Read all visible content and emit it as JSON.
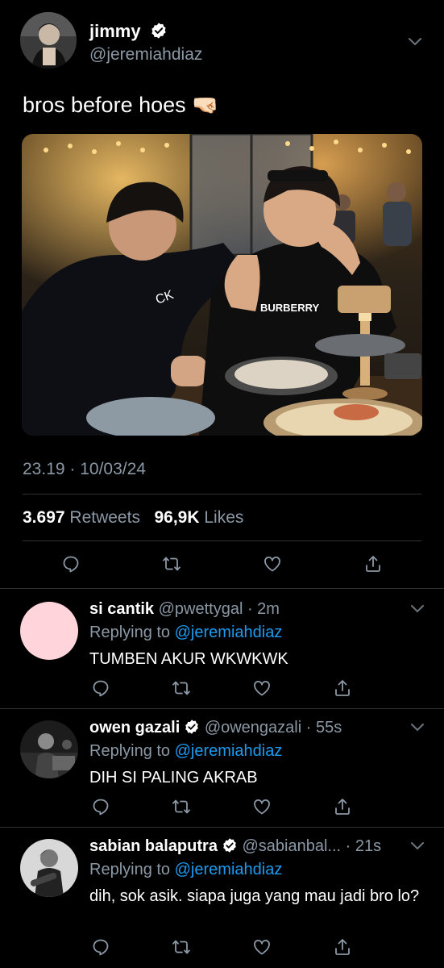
{
  "tweet": {
    "display_name": "jimmy",
    "handle": "@jeremiahdiaz",
    "text": "bros before hoes 🤜🏻",
    "time": "23.19 · 10/03/24",
    "retweets": "3.697",
    "retweets_label": "Retweets",
    "likes": "96,9K",
    "likes_label": "Likes"
  },
  "replies": [
    {
      "name": "si cantik",
      "handle": "@pwettygal · 2m",
      "replying_label": "Replying to",
      "replying_to": "@jeremiahdiaz",
      "text": "TUMBEN AKUR WKWKWK"
    },
    {
      "name": "owen gazali",
      "handle": "@owengazali · 55s",
      "replying_label": "Replying to",
      "replying_to": "@jeremiahdiaz",
      "text": "DIH SI PALING AKRAB"
    },
    {
      "name": "sabian balaputra",
      "handle": "@sabianbal... · 21s",
      "replying_label": "Replying to",
      "replying_to": "@jeremiahdiaz",
      "text": "dih, sok asik. siapa juga yang mau jadi bro lo?"
    }
  ],
  "photo_text": {
    "shirt1": "CK",
    "shirt2": "BURBERRY"
  },
  "colors": {
    "background": "#000000",
    "text": "#e7e9ea",
    "secondary": "#8b98a5",
    "link": "#1d9bf0",
    "divider": "#2f3336",
    "reply_avatar_1": "#ffd5db"
  },
  "icons": [
    "verified-badge-icon",
    "chevron-down-icon",
    "reply-icon",
    "retweet-icon",
    "like-icon",
    "share-icon"
  ]
}
